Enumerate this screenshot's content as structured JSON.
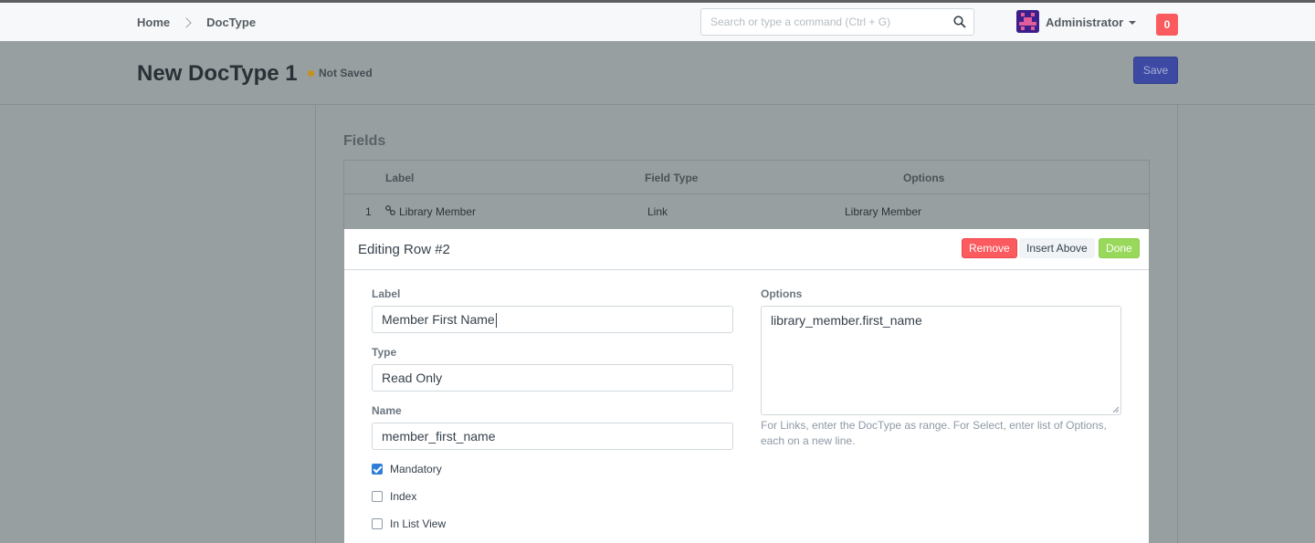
{
  "breadcrumb": {
    "home": "Home",
    "current": "DocType"
  },
  "search": {
    "placeholder": "Search or type a command (Ctrl + G)"
  },
  "user": {
    "name": "Administrator",
    "notifications": "0"
  },
  "page": {
    "title": "New DocType 1",
    "status": "Not Saved",
    "save_label": "Save"
  },
  "fields_section": {
    "title": "Fields",
    "columns": {
      "label": "Label",
      "field_type": "Field Type",
      "options": "Options"
    },
    "rows": [
      {
        "idx": "1",
        "label": "Library Member",
        "field_type": "Link",
        "options": "Library Member"
      }
    ]
  },
  "editor": {
    "title": "Editing Row #2",
    "remove_label": "Remove",
    "insert_above_label": "Insert Above",
    "done_label": "Done",
    "label_caption": "Label",
    "label_value": "Member First Name",
    "type_caption": "Type",
    "type_value": "Read Only",
    "name_caption": "Name",
    "name_value": "member_first_name",
    "options_caption": "Options",
    "options_value": "library_member.first_name",
    "options_help": "For Links, enter the DocType as range. For Select, enter list of Options, each on a new line.",
    "checkboxes": [
      {
        "label": "Mandatory",
        "checked": true
      },
      {
        "label": "Index",
        "checked": false
      },
      {
        "label": "In List View",
        "checked": false
      }
    ]
  },
  "colors": {
    "primary": "#3d4aa3",
    "danger": "#fb5a5f",
    "success": "#98d85b",
    "checkbox": "#2f7fd8"
  },
  "icons": [
    "search-icon",
    "link-icon",
    "chevron-right-icon",
    "caret-down-icon",
    "avatar"
  ]
}
